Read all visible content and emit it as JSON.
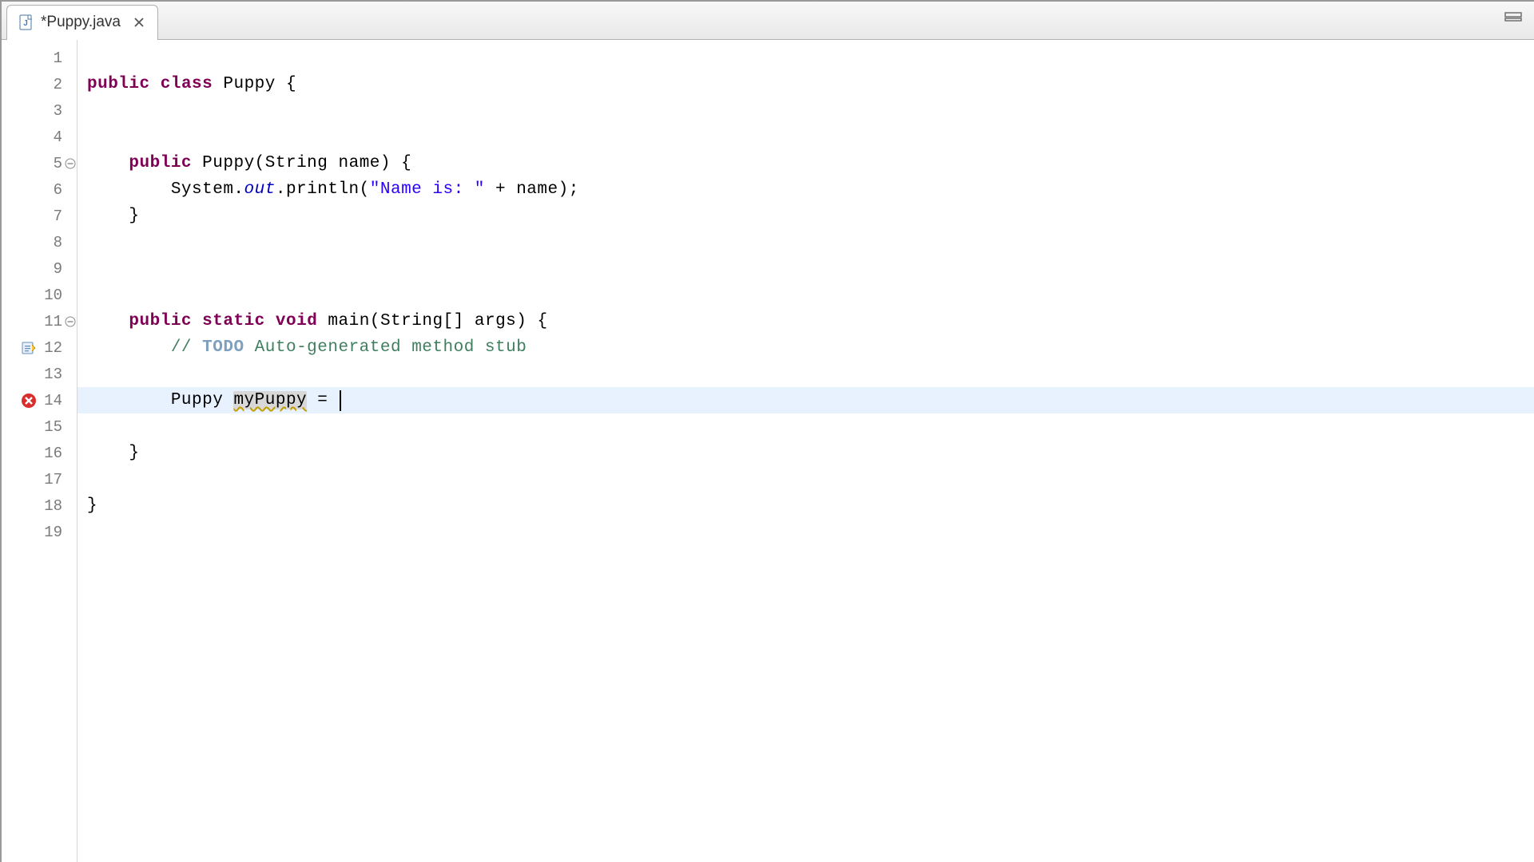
{
  "tab": {
    "label": "*Puppy.java",
    "icon": "java-file-icon",
    "close_icon": "close-icon"
  },
  "controls": {
    "minimize_icon": "minimize-icon"
  },
  "code": {
    "lines": [
      {
        "num": "1",
        "tokens": []
      },
      {
        "num": "2",
        "tokens": [
          {
            "t": "public",
            "c": "kw"
          },
          {
            "t": " "
          },
          {
            "t": "class",
            "c": "kw"
          },
          {
            "t": " "
          },
          {
            "t": "Puppy",
            "c": "type"
          },
          {
            "t": " {"
          }
        ]
      },
      {
        "num": "3",
        "tokens": []
      },
      {
        "num": "4",
        "tokens": []
      },
      {
        "num": "5",
        "foldable": true,
        "tokens": [
          {
            "t": "    "
          },
          {
            "t": "public",
            "c": "kw"
          },
          {
            "t": " "
          },
          {
            "t": "Puppy",
            "c": "method"
          },
          {
            "t": "(String name) {"
          }
        ]
      },
      {
        "num": "6",
        "tokens": [
          {
            "t": "        System."
          },
          {
            "t": "out",
            "c": "field-static"
          },
          {
            "t": ".println("
          },
          {
            "t": "\"Name is: \"",
            "c": "str"
          },
          {
            "t": " + name);"
          }
        ]
      },
      {
        "num": "7",
        "tokens": [
          {
            "t": "    }"
          }
        ]
      },
      {
        "num": "8",
        "tokens": []
      },
      {
        "num": "9",
        "tokens": []
      },
      {
        "num": "10",
        "tokens": []
      },
      {
        "num": "11",
        "foldable": true,
        "tokens": [
          {
            "t": "    "
          },
          {
            "t": "public",
            "c": "kw"
          },
          {
            "t": " "
          },
          {
            "t": "static",
            "c": "kw"
          },
          {
            "t": " "
          },
          {
            "t": "void",
            "c": "kw"
          },
          {
            "t": " "
          },
          {
            "t": "main",
            "c": "method"
          },
          {
            "t": "(String[] args) {"
          }
        ]
      },
      {
        "num": "12",
        "quickfix": true,
        "tokens": [
          {
            "t": "        "
          },
          {
            "t": "// ",
            "c": "comment"
          },
          {
            "t": "TODO",
            "c": "todo"
          },
          {
            "t": " Auto-generated method stub",
            "c": "comment"
          }
        ]
      },
      {
        "num": "13",
        "tokens": []
      },
      {
        "num": "14",
        "error": true,
        "highlight": true,
        "tokens": [
          {
            "t": "        Puppy "
          },
          {
            "t": "myPuppy",
            "c": "warning-underline var-highlight"
          },
          {
            "t": " = "
          },
          {
            "t": "",
            "cursor": true
          }
        ]
      },
      {
        "num": "15",
        "tokens": []
      },
      {
        "num": "16",
        "tokens": [
          {
            "t": "    }"
          }
        ]
      },
      {
        "num": "17",
        "tokens": []
      },
      {
        "num": "18",
        "tokens": [
          {
            "t": "}"
          }
        ]
      },
      {
        "num": "19",
        "tokens": []
      }
    ]
  }
}
